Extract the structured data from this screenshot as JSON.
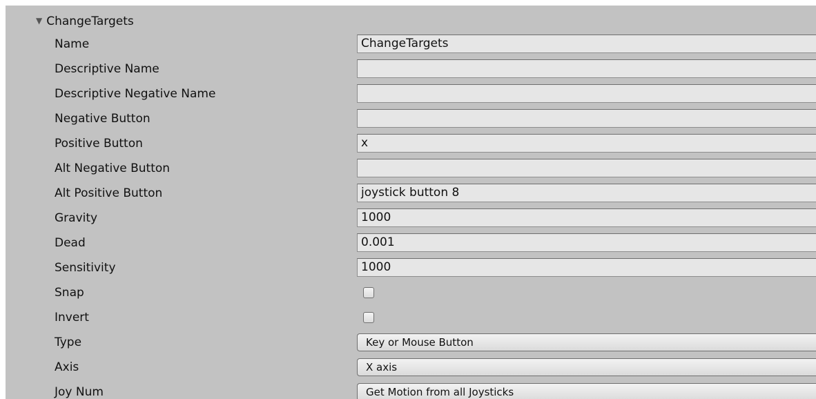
{
  "section": {
    "title": "ChangeTargets",
    "expanded": true
  },
  "fields": {
    "name": {
      "label": "Name",
      "value": "ChangeTargets"
    },
    "descriptive_name": {
      "label": "Descriptive Name",
      "value": ""
    },
    "descriptive_negative_name": {
      "label": "Descriptive Negative Name",
      "value": ""
    },
    "negative_button": {
      "label": "Negative Button",
      "value": ""
    },
    "positive_button": {
      "label": "Positive Button",
      "value": "x"
    },
    "alt_negative_button": {
      "label": "Alt Negative Button",
      "value": ""
    },
    "alt_positive_button": {
      "label": "Alt Positive Button",
      "value": "joystick button 8"
    },
    "gravity": {
      "label": "Gravity",
      "value": "1000"
    },
    "dead": {
      "label": "Dead",
      "value": "0.001"
    },
    "sensitivity": {
      "label": "Sensitivity",
      "value": "1000"
    },
    "snap": {
      "label": "Snap",
      "checked": false
    },
    "invert": {
      "label": "Invert",
      "checked": false
    },
    "type": {
      "label": "Type",
      "selected": "Key or Mouse Button"
    },
    "axis": {
      "label": "Axis",
      "selected": "X axis"
    },
    "joy_num": {
      "label": "Joy Num",
      "selected": "Get Motion from all Joysticks"
    }
  }
}
